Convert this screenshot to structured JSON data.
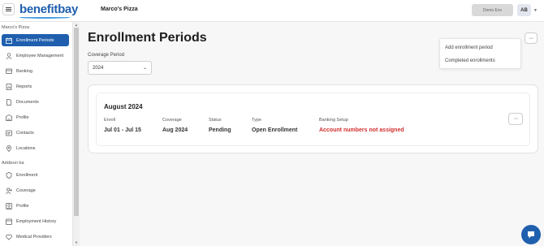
{
  "header": {
    "logo": "benefitbay",
    "company": "Marco's Pizza",
    "env_badge": "Demo Env",
    "avatar_initials": "AB"
  },
  "sidebar": {
    "group1_label": "Marco's Pizza",
    "group1_items": [
      {
        "label": "Enrollment Periods",
        "icon": "calendar-icon",
        "active": true
      },
      {
        "label": "Employee Management",
        "icon": "person-icon"
      },
      {
        "label": "Banking",
        "icon": "bank-icon"
      },
      {
        "label": "Reports",
        "icon": "report-icon"
      },
      {
        "label": "Documents",
        "icon": "document-icon"
      },
      {
        "label": "Profile",
        "icon": "building-icon"
      },
      {
        "label": "Contacts",
        "icon": "contacts-icon"
      },
      {
        "label": "Locations",
        "icon": "location-icon"
      }
    ],
    "group2_label": "Addison ba",
    "group2_items": [
      {
        "label": "Enrollment",
        "icon": "shield-icon"
      },
      {
        "label": "Coverage",
        "icon": "coverage-icon"
      },
      {
        "label": "Profile",
        "icon": "profile-icon"
      },
      {
        "label": "Employment History",
        "icon": "history-icon"
      },
      {
        "label": "Medical Providers",
        "icon": "medical-icon"
      }
    ]
  },
  "main": {
    "title": "Enrollment Periods",
    "coverage_period_label": "Coverage Period",
    "coverage_period_value": "2024",
    "menu": {
      "more": "···",
      "items": [
        "Add enrollment period",
        "Completed enrollments"
      ]
    },
    "period": {
      "title": "August 2024",
      "fields": [
        {
          "label": "Enroll",
          "value": "Jul 01 - Jul 15"
        },
        {
          "label": "Coverage",
          "value": "Aug 2024"
        },
        {
          "label": "Status",
          "value": "Pending"
        },
        {
          "label": "Type",
          "value": "Open Enrollment"
        },
        {
          "label": "Banking Setup",
          "value": "Account numbers not assigned"
        }
      ],
      "more": "···"
    }
  },
  "colors": {
    "brand": "#1f5fae",
    "alert": "#d32f2f"
  }
}
